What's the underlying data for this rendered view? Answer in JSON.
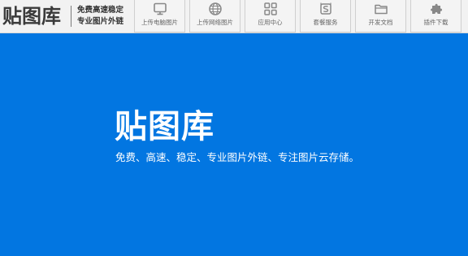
{
  "brand": {
    "logo_text": "贴图库",
    "slogan_line1": "免费高速稳定",
    "slogan_line2": "专业图片外链"
  },
  "nav": {
    "items": [
      {
        "label": "上传电脑图片",
        "icon": "monitor-icon"
      },
      {
        "label": "上传网络图片",
        "icon": "globe-icon"
      },
      {
        "label": "应用中心",
        "icon": "apps-grid-icon"
      },
      {
        "label": "套餐服务",
        "icon": "package-icon"
      },
      {
        "label": "开发文档",
        "icon": "folder-icon"
      },
      {
        "label": "插件下载",
        "icon": "puzzle-icon"
      }
    ]
  },
  "hero": {
    "title": "贴图库",
    "subtitle": "免费、高速、稳定、专业图片外链、专注图片云存储。"
  },
  "colors": {
    "hero_background": "#0276e1",
    "topbar_background": "#f2f2f2",
    "nav_icon": "#888888"
  }
}
